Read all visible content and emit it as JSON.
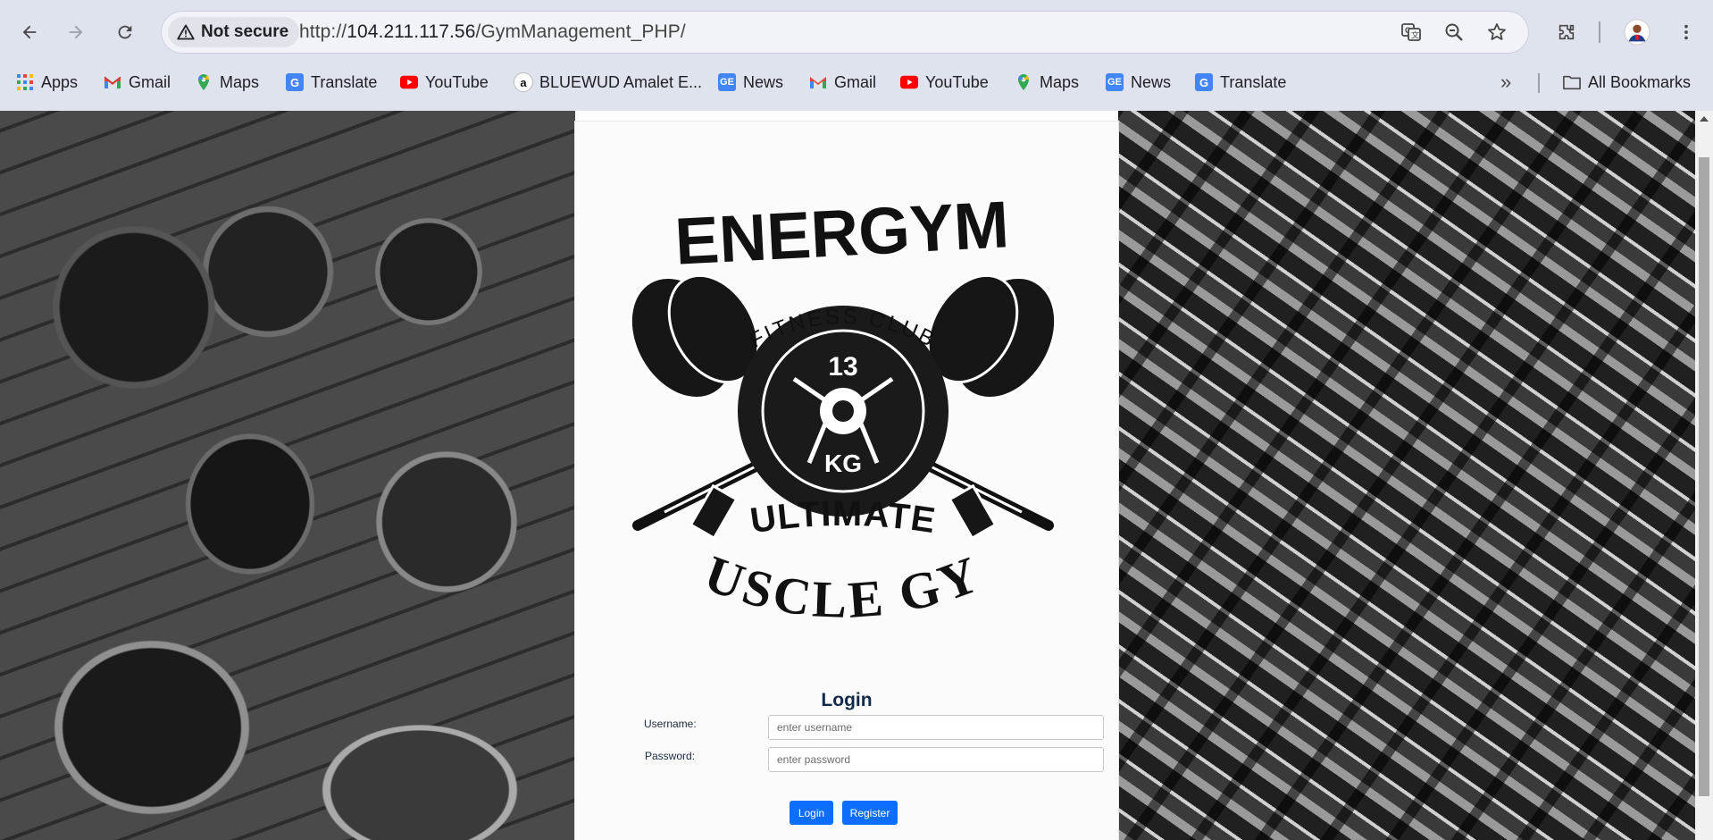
{
  "browser": {
    "security_label": "Not secure",
    "url_prefix": "http://",
    "url_host": "104.211.117.56",
    "url_path": "/GymManagement_PHP/",
    "bookmarks": [
      {
        "label": "Apps",
        "icon": "apps-grid-icon"
      },
      {
        "label": "Gmail",
        "icon": "gmail-icon"
      },
      {
        "label": "Maps",
        "icon": "maps-icon"
      },
      {
        "label": "Translate",
        "icon": "translate-icon"
      },
      {
        "label": "YouTube",
        "icon": "youtube-icon"
      },
      {
        "label": "BLUEWUD Amalet E...",
        "icon": "amazon-icon"
      },
      {
        "label": "News",
        "icon": "news-icon"
      },
      {
        "label": "Gmail",
        "icon": "gmail-icon"
      },
      {
        "label": "YouTube",
        "icon": "youtube-icon"
      },
      {
        "label": "Maps",
        "icon": "maps-icon"
      },
      {
        "label": "News",
        "icon": "news-icon"
      },
      {
        "label": "Translate",
        "icon": "translate-icon"
      }
    ],
    "overflow_label": "»",
    "all_bookmarks_label": "All Bookmarks"
  },
  "logo": {
    "brand": "ENERGYM",
    "tagline": "FITNESS CLUB",
    "plate_number": "13",
    "plate_unit": "KG",
    "line1": "ULTIMATE",
    "line2": "MUSCLE GYM"
  },
  "login": {
    "title": "Login",
    "username_label": "Username:",
    "username_placeholder": "enter username",
    "password_label": "Password:",
    "password_placeholder": "enter password",
    "login_button": "Login",
    "register_button": "Register"
  },
  "colors": {
    "primary_button": "#0d6efd",
    "title_text": "#0f2a4a"
  }
}
